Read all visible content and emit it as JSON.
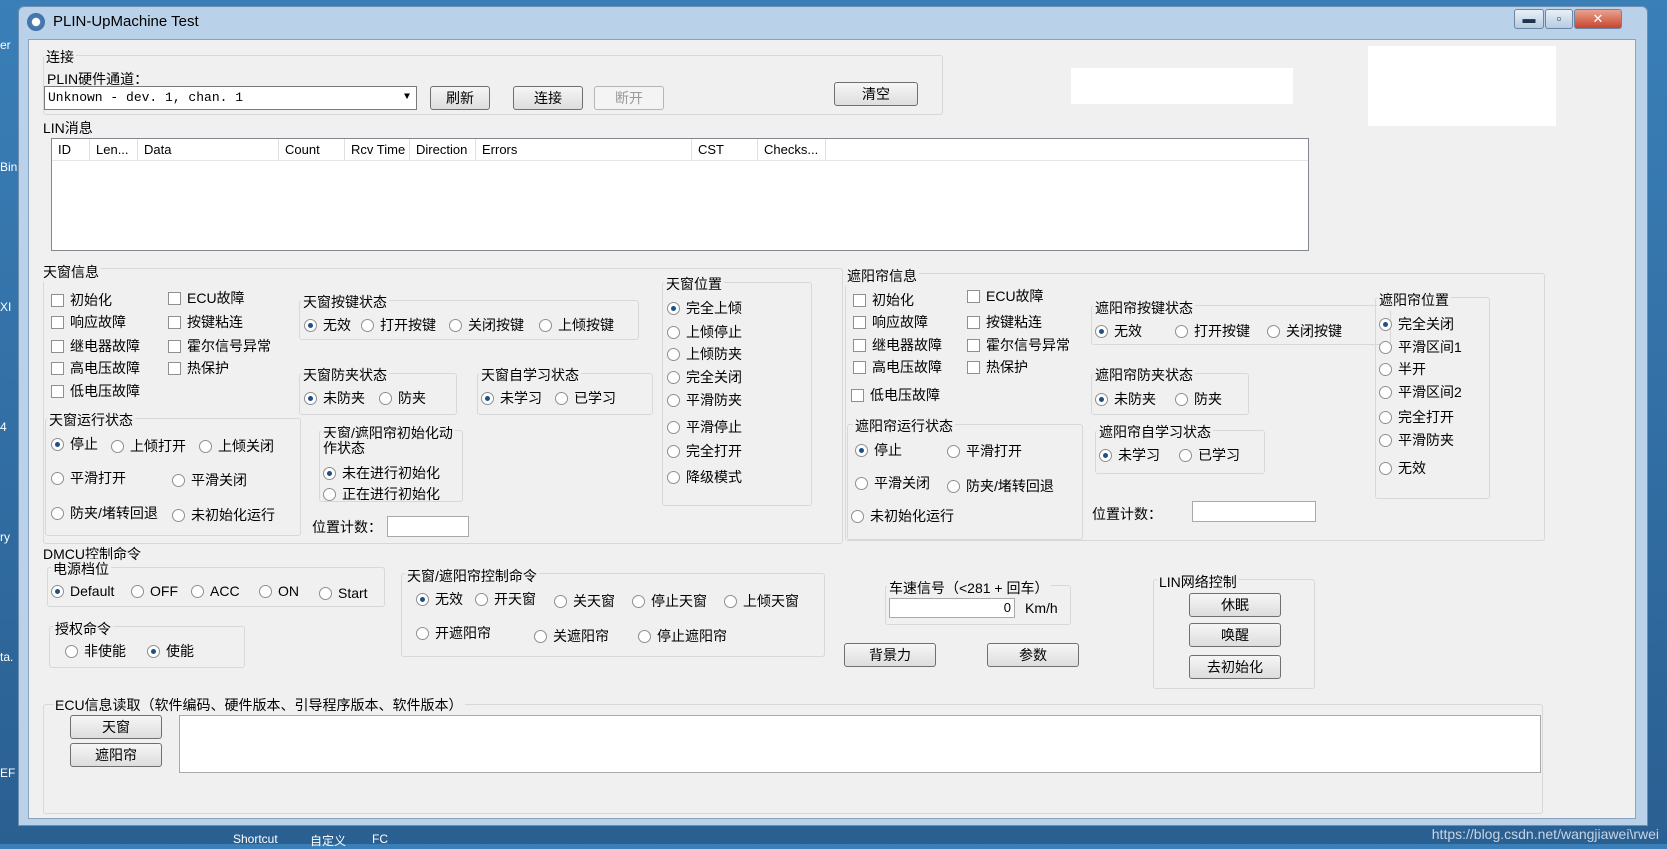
{
  "window": {
    "title": "PLIN-UpMachine Test",
    "min_label": "▬",
    "max_label": "▫",
    "close_label": "✕"
  },
  "connect": {
    "group_label": "连接",
    "hw_label": "PLIN硬件通道：",
    "hw_value": "Unknown - dev. 1, chan. 1",
    "refresh": "刷新",
    "connect": "连接",
    "disconnect": "断开",
    "clear": "清空"
  },
  "lin": {
    "group_label": "LIN消息",
    "columns": [
      "ID",
      "Len...",
      "Data",
      "Count",
      "Rcv Time",
      "Direction",
      "Errors",
      "CST",
      "Checks..."
    ]
  },
  "sunroof": {
    "group_label": "天窗信息",
    "faults": [
      "初始化",
      "ECU故障",
      "响应故障",
      "按键粘连",
      "继电器故障",
      "霍尔信号异常",
      "高电压故障",
      "热保护",
      "低电压故障"
    ],
    "key_state": {
      "label": "天窗按键状态",
      "options": [
        "无效",
        "打开按键",
        "关闭按键",
        "上倾按键"
      ],
      "selected": "无效"
    },
    "anti_pinch": {
      "label": "天窗防夹状态",
      "options": [
        "未防夹",
        "防夹"
      ],
      "selected": "未防夹"
    },
    "self_learn": {
      "label": "天窗自学习状态",
      "options": [
        "未学习",
        "已学习"
      ],
      "selected": "未学习"
    },
    "position": {
      "label": "天窗位置",
      "options": [
        "完全上倾",
        "上倾停止",
        "上倾防夹",
        "完全关闭",
        "平滑防夹",
        "平滑停止",
        "完全打开",
        "降级模式"
      ],
      "selected": "完全上倾"
    },
    "run_state": {
      "label": "天窗运行状态",
      "options": [
        "停止",
        "上倾打开",
        "上倾关闭",
        "平滑打开",
        "平滑关闭",
        "防夹/堵转回退",
        "未初始化运行"
      ],
      "selected": "停止"
    },
    "init_state": {
      "label_line1": "天窗/遮阳帘初始化动",
      "label_line2": "作状态",
      "options": [
        "未在进行初始化",
        "正在进行初始化"
      ],
      "selected": "未在进行初始化"
    },
    "pos_count_label": "位置计数："
  },
  "shade": {
    "group_label": "遮阳帘信息",
    "faults": [
      "初始化",
      "ECU故障",
      "响应故障",
      "按键粘连",
      "继电器故障",
      "霍尔信号异常",
      "高电压故障",
      "热保护",
      "低电压故障"
    ],
    "key_state": {
      "label": "遮阳帘按键状态",
      "options": [
        "无效",
        "打开按键",
        "关闭按键"
      ],
      "selected": "无效"
    },
    "anti_pinch": {
      "label": "遮阳帘防夹状态",
      "options": [
        "未防夹",
        "防夹"
      ],
      "selected": "未防夹"
    },
    "self_learn": {
      "label": "遮阳帘自学习状态",
      "options": [
        "未学习",
        "已学习"
      ],
      "selected": "未学习"
    },
    "run_state": {
      "label": "遮阳帘运行状态",
      "options": [
        "停止",
        "平滑打开",
        "平滑关闭",
        "防夹/堵转回退",
        "未初始化运行"
      ],
      "selected": "停止"
    },
    "position": {
      "label": "遮阳帘位置",
      "options": [
        "完全关闭",
        "平滑区间1",
        "半开",
        "平滑区间2",
        "完全打开",
        "平滑防夹",
        "无效"
      ],
      "selected": "完全关闭"
    },
    "pos_count_label": "位置计数："
  },
  "dmcu": {
    "group_label": "DMCU控制命令",
    "power": {
      "label": "电源档位",
      "options": [
        "Default",
        "OFF",
        "ACC",
        "ON",
        "Start"
      ],
      "selected": "Default"
    },
    "auth": {
      "label": "授权命令",
      "options": [
        "非使能",
        "使能"
      ],
      "selected": "使能"
    },
    "ctrl": {
      "label": "天窗/遮阳帘控制命令",
      "options": [
        "无效",
        "开天窗",
        "关天窗",
        "停止天窗",
        "上倾天窗",
        "开遮阳帘",
        "关遮阳帘",
        "停止遮阳帘"
      ],
      "selected": "无效"
    },
    "speed": {
      "label": "车速信号（<281 + 回车）",
      "value": "0",
      "unit": "Km/h"
    },
    "backforce": "背景力",
    "params": "参数"
  },
  "lin_net": {
    "label": "LIN网络控制",
    "sleep": "休眠",
    "wake": "唤醒",
    "deinit": "去初始化"
  },
  "ecu": {
    "label": "ECU信息读取（软件编码、硬件版本、引导程序版本、软件版本）",
    "sunroof_btn": "天窗",
    "shade_btn": "遮阳帘"
  },
  "desktop": {
    "watermark": "https://blog.csdn.net/wangjiawei\\rwei",
    "shortcut": "Shortcut",
    "edit": "自定义",
    "fc": "FC",
    "left_texts": [
      "er",
      "Bin",
      "XI",
      "4",
      "ry",
      "ta.",
      "EF"
    ]
  },
  "colors": {
    "window_frame": "#b9d2ea",
    "client_bg": "#f0f0f0",
    "radio_dot": "#1f4f86"
  }
}
